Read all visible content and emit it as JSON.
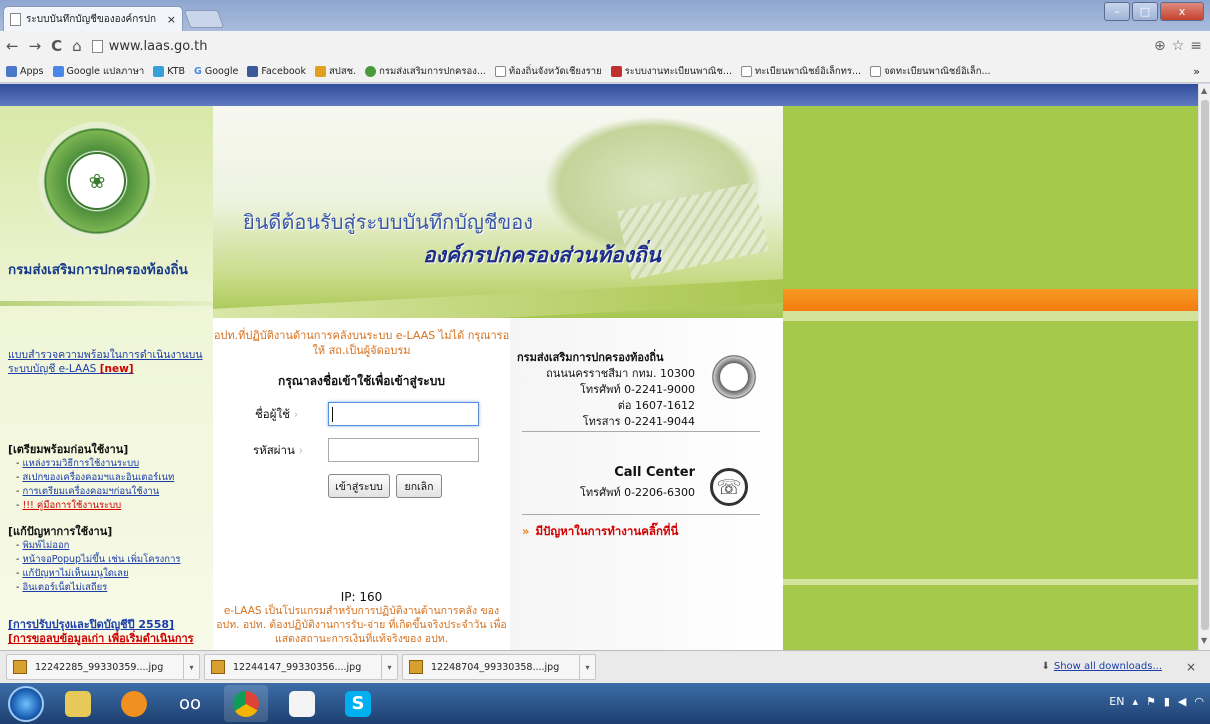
{
  "browser": {
    "tab_title": "ระบบบันทึกบัญชีขององค์กรปก",
    "tab_close": "×",
    "url": "www.laas.go.th",
    "window_buttons": [
      "–",
      "□",
      "x"
    ],
    "nav": {
      "back": "←",
      "forward": "→",
      "reload": "C",
      "home": "⌂"
    },
    "bookmarks": [
      "Apps",
      "Google แปลภาษา",
      "KTB",
      "Google",
      "Facebook",
      "สปสช.",
      "กรมส่งเสริมการปกครอง...",
      "ท้องถิ่นจังหวัดเชียงราย",
      "ระบบงานทะเบียนพาณิช...",
      "ทะเบียนพาณิชย์อิเล็กทร...",
      "จดทะเบียนพาณิชย์อิเล็ก..."
    ],
    "bookmarks_more": "»",
    "colors": {
      "top_strip": "#324d9b",
      "left_bg": "#dbe9ad",
      "right_bg": "#a5c94b",
      "orange": "#f37c10"
    }
  },
  "left": {
    "org_title": "กรมส่งเสริมการปกครองท้องถิ่น",
    "survey": "แบบสำรวจความพร้อมในการดำเนินงานบนระบบบัญชี e-LAAS",
    "survey_new": "[new]",
    "sec1": "[เตรียมพร้อมก่อนใช้งาน]",
    "sec1_items": [
      "แหล่งรวมวิธีการใช้งานระบบ",
      "สเปกของเครื่องคอมฯและอินเตอร์เนท",
      "การเตรียมเครื่องคอมฯก่อนใช้งาน",
      "!!! คู่มือการใช้งานระบบ"
    ],
    "sec2": "[แก้ปัญหาการใช้งาน]",
    "sec2_items": [
      "พิมพ์ไม่ออก",
      "หน้าจอPopupไม่ขึ้น เช่น เพิ่มโครงการ",
      "แก้ปัญหาไม่เห็นเมนูใดเลย",
      "อินเตอร์เน็ตไม่เสถียร"
    ],
    "sec3": "[การปรับปรุงและปิดบัญชีปี 2558]",
    "sec4": "[การขอลบข้อมูลเก่า เพื่อเริ่มดำเนินการ"
  },
  "banner": {
    "line1": "ยินดีต้อนรับสู่ระบบบันทึกบัญชีของ",
    "line2": "องค์กรปกครองส่วนท้องถิ่น"
  },
  "login": {
    "alert": "อปท.ที่ปฏิบัติงานด้านการคลังบนระบบ e-LAAS ไม่ได้ กรุณารอให้ สถ.เป็นผู้จัดอบรม",
    "heading": "กรุณาลงชื่อเข้าใช้เพื่อเข้าสู่ระบบ",
    "user_label": "ชื่อผู้ใช้",
    "pass_label": "รหัสผ่าน",
    "user_value": "",
    "pass_value": "",
    "login_btn": "เข้าสู่ระบบ",
    "cancel_btn": "ยกเลิก",
    "ip": "IP: 160",
    "desc": "e-LAAS เป็นโปรแกรมสำหรับการปฏิบัติงานด้านการคลัง ของ อปท. อปท. ต้องปฏิบัติงานการรับ-จ่าย ที่เกิดขึ้นจริงประจำวัน เพื่อแสดงสถานะการเงินที่แท้จริงของ อปท."
  },
  "contact": {
    "org": "กรมส่งเสริมการปกครองท้องถิ่น",
    "address": "ถนนนครราชสีมา กทม. 10300",
    "phone": "โทรศัพท์ 0-2241-9000",
    "ext": "ต่อ 1607-1612",
    "fax": "โทรสาร 0-2241-9044",
    "call_center": "Call Center",
    "call_phone": "โทรศัพท์ 0-2206-6300",
    "problem": "มีปัญหาในการทำงานคลิ๊กที่นี่",
    "arrow": "»"
  },
  "downloads": {
    "items": [
      "12242285_99330359....jpg",
      "12244147_99330356....jpg",
      "12248704_99330358....jpg"
    ],
    "show_all": "Show all downloads...",
    "close": "×"
  },
  "taskbar": {
    "lang": "EN"
  }
}
